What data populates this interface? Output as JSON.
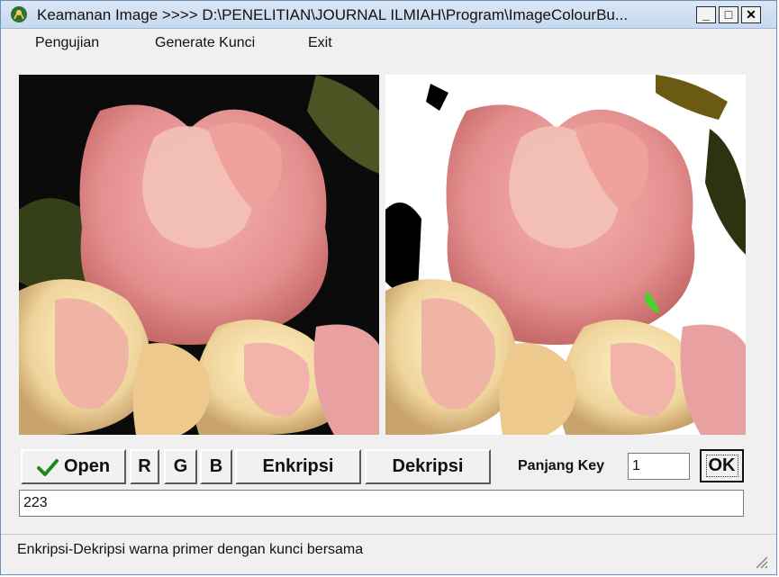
{
  "window": {
    "title": "Keamanan Image >>>> D:\\PENELITIAN\\JOURNAL ILMIAH\\Program\\ImageColourBu...",
    "controls": {
      "minimize": "_",
      "maximize": "□",
      "close": "✕"
    }
  },
  "menu": {
    "items": [
      {
        "label": "Pengujian"
      },
      {
        "label": "Generate Kunci"
      },
      {
        "label": "Exit"
      }
    ]
  },
  "toolbar": {
    "open_label": "Open",
    "r_label": "R",
    "g_label": "G",
    "b_label": "B",
    "enkripsi_label": "Enkripsi",
    "dekripsi_label": "Dekripsi",
    "key_label": "Panjang Key",
    "key_value": "1",
    "ok_label": "OK"
  },
  "output_field": {
    "value": "223"
  },
  "status": {
    "text": "Enkripsi-Dekripsi warna primer dengan kunci bersama"
  },
  "icons": {
    "app": "flower-app-icon",
    "open": "checkmark-icon",
    "grip": "resize-grip-icon"
  },
  "colors": {
    "titlebar": "#c6d9ef",
    "check": "#1a8a1a"
  }
}
